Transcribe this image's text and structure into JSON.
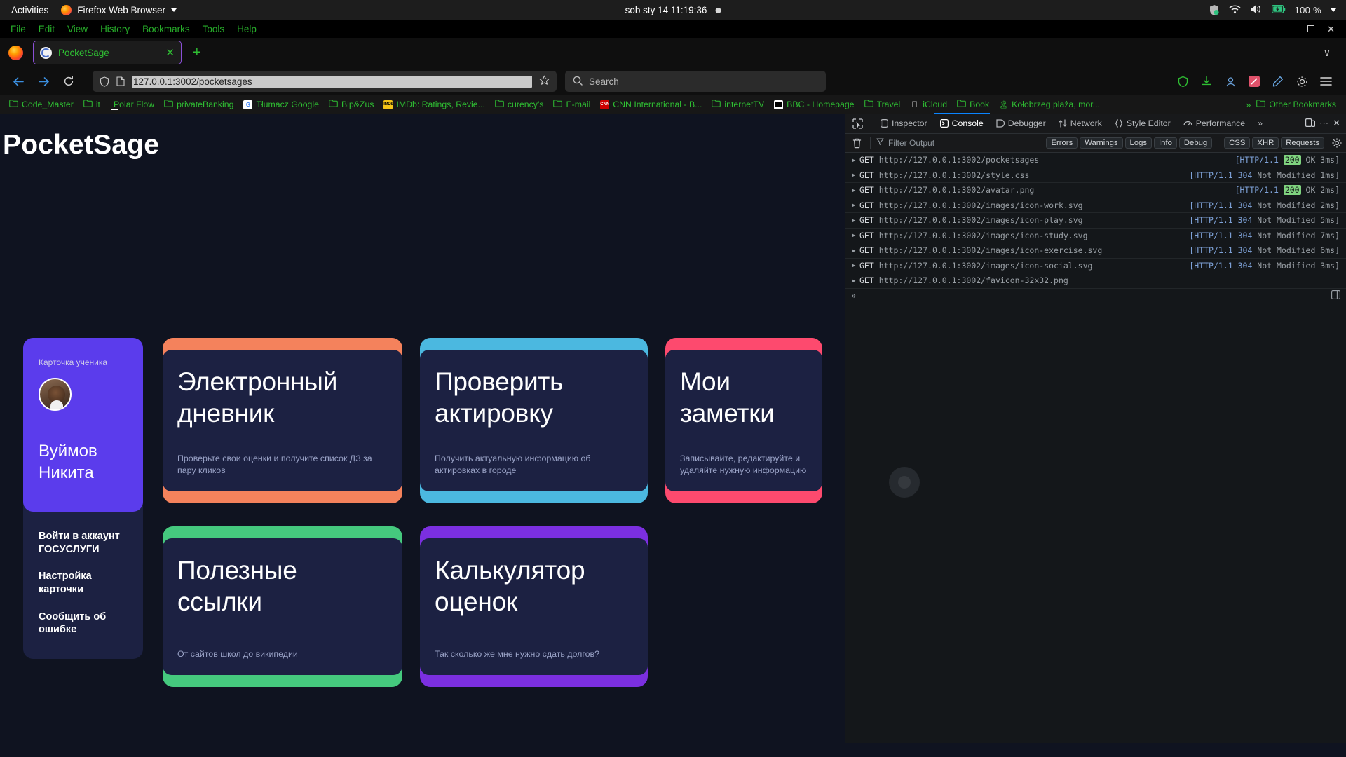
{
  "gnome": {
    "activities": "Activities",
    "app_name": "Firefox Web Browser",
    "clock": "sob sty 14  11:19:36",
    "battery_pct": "100 %"
  },
  "browser": {
    "menus": [
      "File",
      "Edit",
      "View",
      "History",
      "Bookmarks",
      "Tools",
      "Help"
    ],
    "tab": {
      "title": "PocketSage",
      "close_label": "✕"
    },
    "new_tab_label": "+",
    "tablist_more": "∨",
    "url": "127.0.0.1:3002/pocketsages",
    "search_placeholder": "Search",
    "bookmarks": [
      {
        "label": "Code_Master",
        "icon": "folder-icon"
      },
      {
        "label": "it",
        "icon": "folder-icon"
      },
      {
        "label": "Polar Flow",
        "icon": "polar-icon"
      },
      {
        "label": "privateBanking",
        "icon": "folder-icon"
      },
      {
        "label": "Tłumacz Google",
        "icon": "google-translate-icon"
      },
      {
        "label": "Bip&Zus",
        "icon": "folder-icon"
      },
      {
        "label": "IMDb: Ratings, Revie...",
        "icon": "imdb-icon"
      },
      {
        "label": "curency's",
        "icon": "folder-icon"
      },
      {
        "label": "E-mail",
        "icon": "folder-icon"
      },
      {
        "label": "CNN International - B...",
        "icon": "cnn-icon"
      },
      {
        "label": "internetTV",
        "icon": "folder-icon"
      },
      {
        "label": "BBC - Homepage",
        "icon": "bbc-icon"
      },
      {
        "label": "Travel",
        "icon": "folder-icon"
      },
      {
        "label": "iCloud",
        "icon": "apple-icon"
      },
      {
        "label": "Book",
        "icon": "folder-icon"
      },
      {
        "label": "Kołobrzeg plaża, mor...",
        "icon": "page-icon"
      }
    ],
    "bookmarks_overflow": "»",
    "other_bookmarks": "Other Bookmarks"
  },
  "page": {
    "title": "PocketSage",
    "profile": {
      "label": "Карточка ученика",
      "name": "Вуймов Никита",
      "links": [
        "Войти в аккаунт ГОСУСЛУГИ",
        "Настройка карточки",
        "Сообщить об ошибке"
      ]
    },
    "tiles": [
      {
        "title": "Электронный дневник",
        "desc": "Проверьте свои оценки и получите список ДЗ за пару кликов",
        "color": "#f4825c"
      },
      {
        "title": "Проверить актировку",
        "desc": "Получить актуальную информацию об актировках в городе",
        "color": "#4bb8e0"
      },
      {
        "title": "Мои заметки",
        "desc": "Записывайте, редактируйте и удаляйте нужную информацию",
        "color": "#fd4a6e"
      },
      {
        "title": "Полезные ссылки",
        "desc": "От сайтов школ до википедии",
        "color": "#45c97e"
      },
      {
        "title": "Калькулятор оценок",
        "desc": "Так сколько же мне нужно сдать долгов?",
        "color": "#7b2fe0"
      }
    ]
  },
  "devtools": {
    "tabs": [
      {
        "label": "Inspector",
        "active": false
      },
      {
        "label": "Console",
        "active": true
      },
      {
        "label": "Debugger",
        "active": false
      },
      {
        "label": "Network",
        "active": false
      },
      {
        "label": "Style Editor",
        "active": false
      },
      {
        "label": "Performance",
        "active": false
      }
    ],
    "tabs_overflow": "»",
    "filter_placeholder": "Filter Output",
    "filters": [
      "Errors",
      "Warnings",
      "Logs",
      "Info",
      "Debug"
    ],
    "filters2": [
      "CSS",
      "XHR",
      "Requests"
    ],
    "prompt": "»",
    "rows": [
      {
        "method": "GET",
        "url": "http://127.0.0.1:3002/pocketsages",
        "proto": "[HTTP/1.1",
        "code": "200",
        "rest": "OK 3ms]",
        "ok": true
      },
      {
        "method": "GET",
        "url": "http://127.0.0.1:3002/style.css",
        "proto": "[HTTP/1.1",
        "code": "304",
        "rest": "Not Modified 1ms]",
        "ok": false
      },
      {
        "method": "GET",
        "url": "http://127.0.0.1:3002/avatar.png",
        "proto": "[HTTP/1.1",
        "code": "200",
        "rest": "OK 2ms]",
        "ok": true
      },
      {
        "method": "GET",
        "url": "http://127.0.0.1:3002/images/icon-work.svg",
        "proto": "[HTTP/1.1",
        "code": "304",
        "rest": "Not Modified 2ms]",
        "ok": false
      },
      {
        "method": "GET",
        "url": "http://127.0.0.1:3002/images/icon-play.svg",
        "proto": "[HTTP/1.1",
        "code": "304",
        "rest": "Not Modified 5ms]",
        "ok": false
      },
      {
        "method": "GET",
        "url": "http://127.0.0.1:3002/images/icon-study.svg",
        "proto": "[HTTP/1.1",
        "code": "304",
        "rest": "Not Modified 7ms]",
        "ok": false
      },
      {
        "method": "GET",
        "url": "http://127.0.0.1:3002/images/icon-exercise.svg",
        "proto": "[HTTP/1.1",
        "code": "304",
        "rest": "Not Modified 6ms]",
        "ok": false
      },
      {
        "method": "GET",
        "url": "http://127.0.0.1:3002/images/icon-social.svg",
        "proto": "[HTTP/1.1",
        "code": "304",
        "rest": "Not Modified 3ms]",
        "ok": false
      },
      {
        "method": "GET",
        "url": "http://127.0.0.1:3002/favicon-32x32.png",
        "proto": "",
        "code": "",
        "rest": "",
        "ok": false
      }
    ]
  }
}
